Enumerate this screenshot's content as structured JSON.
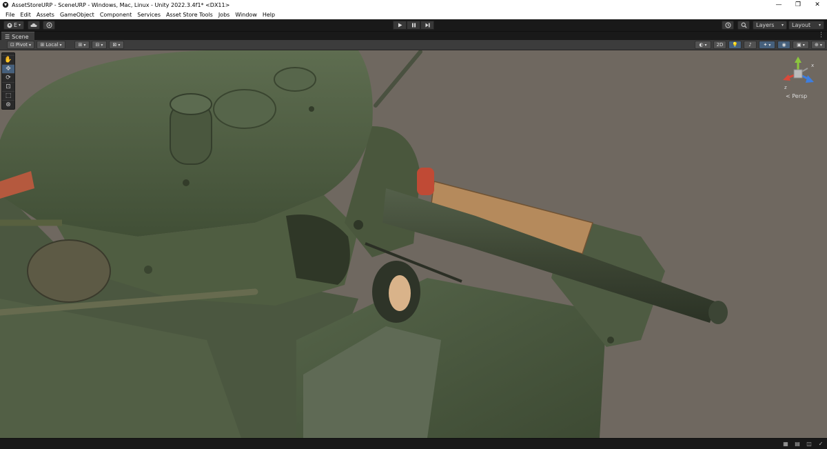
{
  "window": {
    "title": "AssetStoreURP - SceneURP - Windows, Mac, Linux - Unity 2022.3.4f1* <DX11>",
    "minimize": "—",
    "maximize": "❐",
    "close": "✕"
  },
  "menu": [
    "File",
    "Edit",
    "Assets",
    "GameObject",
    "Component",
    "Services",
    "Asset Store Tools",
    "Jobs",
    "Window",
    "Help"
  ],
  "toolbar": {
    "account_label": "E",
    "layers_label": "Layers",
    "layout_label": "Layout"
  },
  "tabs": {
    "scene_label": "Scene"
  },
  "scene_toolbar": {
    "pivot_label": "Pivot",
    "local_label": "Local",
    "mode_2d_label": "2D"
  },
  "gizmo": {
    "projection_label": "Persp",
    "x_axis_label": "x",
    "z_axis_label": "z"
  },
  "colors": {
    "accent_active": "#46607c",
    "scene_background": "#6f6860",
    "tank_green": "#4a5a3a",
    "gizmo_x": "#d9493a",
    "gizmo_y": "#8cc63e",
    "gizmo_z": "#3d7ee0"
  },
  "icons": {
    "tools": [
      "hand-icon",
      "move-icon",
      "rotate-icon",
      "scale-icon",
      "rect-icon",
      "transform-icon"
    ]
  }
}
